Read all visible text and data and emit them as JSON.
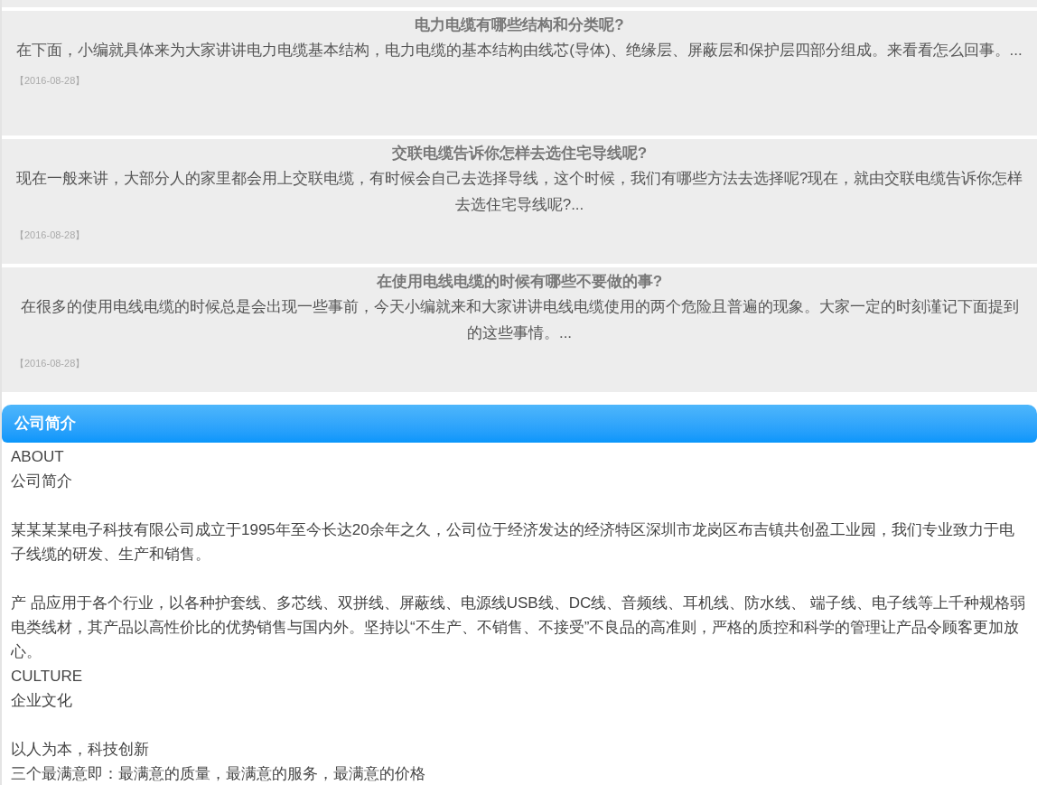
{
  "articles": [
    {
      "title": "电力电缆有哪些结构和分类呢?",
      "summary": "在下面，小编就具体来为大家讲讲电力电缆基本结构，电力电缆的基本结构由线芯(导体)、绝缘层、屏蔽层和保护层四部分组成。来看看怎么回事。...",
      "date": "【2016-08-28】"
    },
    {
      "title": "交联电缆告诉你怎样去选住宅导线呢?",
      "summary": "现在一般来讲，大部分人的家里都会用上交联电缆，有时候会自己去选择导线，这个时候，我们有哪些方法去选择呢?现在，就由交联电缆告诉你怎样去选住宅导线呢?...",
      "date": "【2016-08-28】"
    },
    {
      "title": "在使用电线电缆的时候有哪些不要做的事?",
      "summary": "在很多的使用电线电缆的时候总是会出现一些事前，今天小编就来和大家讲讲电线电缆使用的两个危险且普遍的现象。大家一定的时刻谨记下面提到的这些事情。...",
      "date": "【2016-08-28】"
    }
  ],
  "about": {
    "header": "公司简介",
    "blocks": [
      [
        "ABOUT",
        "公司简介"
      ],
      [
        "某某某某电子科技有限公司成立于1995年至今长达20余年之久，公司位于经济发达的经济特区深圳市龙岗区布吉镇共创盈工业园，我们专业致力于电子线缆的研发、生产和销售。"
      ],
      [
        "产 品应用于各个行业，以各种护套线、多芯线、双拼线、屏蔽线、电源线USB线、DC线、音频线、耳机线、防水线、 端子线、电子线等上千种规格弱电类线材，其产品以高性价比的优势销售与国内外。坚持以“不生产、不销售、不接受”不良品的高准则，严格的质控和科学的管理让产品令顾客更加放心。",
        "CULTURE",
        "企业文化"
      ],
      [
        "以人为本，科技创新",
        "三个最满意即：最满意的质量，最满意的服务，最满意的价格"
      ]
    ]
  }
}
